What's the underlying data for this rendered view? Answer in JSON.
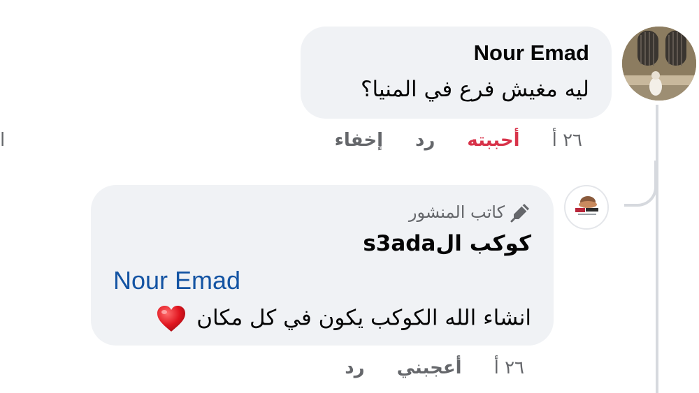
{
  "comment": {
    "author": "Nour Emad",
    "text": "ليه مغيش فرع في المنيا؟",
    "actions": {
      "time": "٢٦ أ",
      "like": "أحببته",
      "reply": "رد",
      "hide": "إخفاء"
    },
    "like_color": "#d8334a"
  },
  "reply": {
    "badge": "كاتب المنشور",
    "author": "كوكب الs3ada",
    "mention": "Nour Emad",
    "text": "انشاء الله الكوكب يكون في كل مكان",
    "emoji": "red-heart-emoji",
    "actions": {
      "time": "٢٦ أ",
      "like": "أعجبني",
      "reply": "رد"
    },
    "mention_color": "#1454a3"
  },
  "edge_fragment": "ا",
  "colors": {
    "bubble": "#f0f2f5",
    "secondary_text": "#65676b",
    "primary_text": "#050505",
    "thread_line": "#d6d9de"
  }
}
